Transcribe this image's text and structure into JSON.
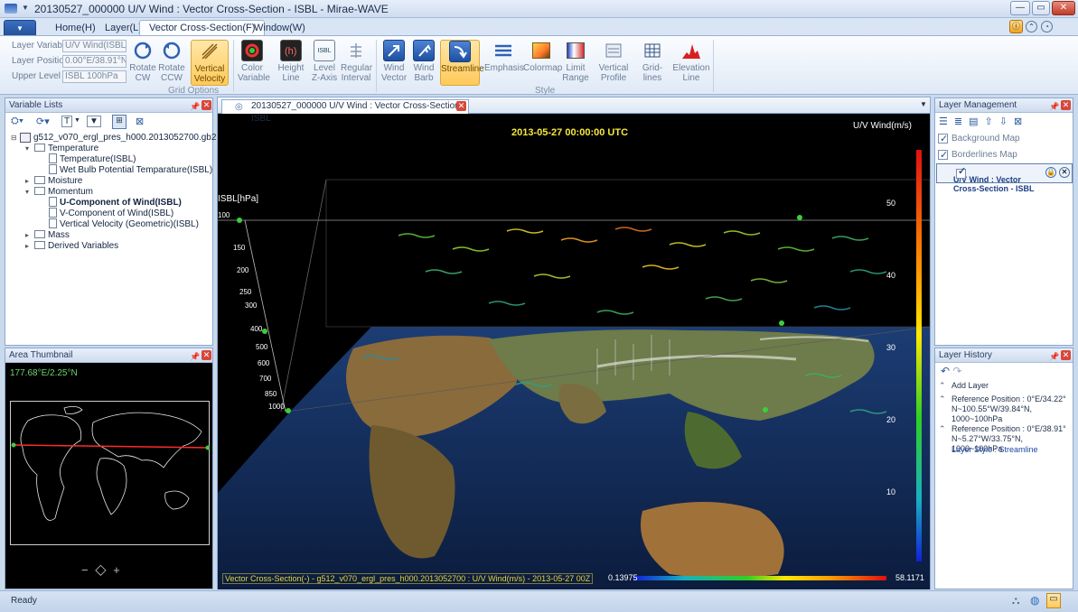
{
  "titlebar": {
    "title": "20130527_000000 U/V Wind : Vector Cross-Section - ISBL - Mirae-WAVE"
  },
  "tabs": [
    "Home(H)",
    "Layer(L)",
    "Vector Cross-Section(F)",
    "Window(W)"
  ],
  "ribbon": {
    "fields": [
      {
        "label": "Layer Variable",
        "value": "U/V Wind(ISBL)"
      },
      {
        "label": "Layer Position",
        "value": "0.00°E/38.91°N~"
      },
      {
        "label": "Upper Level",
        "value": "ISBL 100hPa"
      }
    ],
    "buttons": [
      {
        "label": "Rotate\nCW",
        "icon": "rotate-cw-icon"
      },
      {
        "label": "Rotate\nCCW",
        "icon": "rotate-ccw-icon"
      },
      {
        "label": "Vertical\nVelocity",
        "icon": "vertical-velocity-icon"
      },
      {
        "label": "Color\nVariable",
        "icon": "color-variable-icon"
      },
      {
        "label": "Height\nLine",
        "icon": "height-line-icon"
      },
      {
        "label": "Level\nZ-Axis",
        "icon": "level-zaxis-icon"
      },
      {
        "label": "Regular\nInterval",
        "icon": "regular-interval-icon"
      },
      {
        "label": "Wind\nVector",
        "icon": "wind-vector-icon"
      },
      {
        "label": "Wind\nBarb",
        "icon": "wind-barb-icon"
      },
      {
        "label": "Streamline",
        "icon": "streamline-icon"
      },
      {
        "label": "Emphasis",
        "icon": "emphasis-icon"
      },
      {
        "label": "Colormap",
        "icon": "colormap-icon"
      },
      {
        "label": "Limit\nRange",
        "icon": "limit-range-icon"
      },
      {
        "label": "Vertical\nProfile",
        "icon": "vertical-profile-icon"
      },
      {
        "label": "Grid-lines",
        "icon": "grid-lines-icon"
      },
      {
        "label": "Elevation\nLine",
        "icon": "elevation-line-icon"
      }
    ],
    "groups": {
      "grid_options": "Grid Options",
      "style": "Style"
    },
    "ribbon_icon_text": "ISBL"
  },
  "variables": {
    "title": "Variable Lists",
    "file": "g512_v070_ergl_pres_h000.2013052700.gb2",
    "tree": [
      {
        "label": "Temperature",
        "type": "folder",
        "depth": 1,
        "open": true
      },
      {
        "label": "Temperature(ISBL)",
        "type": "doc",
        "depth": 2
      },
      {
        "label": "Wet Bulb Potential Temparature(ISBL)",
        "type": "doc",
        "depth": 2
      },
      {
        "label": "Moisture",
        "type": "folder",
        "depth": 1,
        "open": false
      },
      {
        "label": "Momentum",
        "type": "folder",
        "depth": 1,
        "open": true
      },
      {
        "label": "U-Component of Wind(ISBL)",
        "type": "doc",
        "depth": 2,
        "bold": true
      },
      {
        "label": "V-Component of Wind(ISBL)",
        "type": "doc",
        "depth": 2
      },
      {
        "label": "Vertical Velocity (Geometric)(ISBL)",
        "type": "doc",
        "depth": 2
      },
      {
        "label": "Mass",
        "type": "folder",
        "depth": 1,
        "open": false
      },
      {
        "label": "Derived Variables",
        "type": "folder",
        "depth": 1,
        "open": false
      }
    ]
  },
  "thumbnail": {
    "title": "Area Thumbnail",
    "coords": "177.68°E/2.25°N"
  },
  "view": {
    "tab": "20130527_000000 U/V Wind : Vector Cross-Section - ISBL",
    "datetime": "2013-05-27 00:00:00 UTC",
    "colorbar_title": "U/V Wind(m/s)",
    "colorbar_ticks": [
      "50",
      "40",
      "30",
      "20",
      "10"
    ],
    "axis_title": "ISBL[hPa]",
    "levels": [
      "100",
      "150",
      "200",
      "250",
      "300",
      "400",
      "500",
      "600",
      "700",
      "850",
      "1000"
    ],
    "footer": "Vector Cross-Section(-) - g512_v070_ergl_pres_h000.2013052700 : U/V Wind(m/s) - 2013-05-27 00Z",
    "min": "0.13975",
    "max": "58.1171"
  },
  "layers": {
    "title": "Layer Management",
    "items": [
      {
        "label": "Background Map"
      },
      {
        "label": "Borderlines Map"
      },
      {
        "label": "U/V Wind : Vector Cross-Section - ISBL"
      }
    ]
  },
  "history": {
    "title": "Layer History",
    "items": [
      "Add Layer",
      "Reference Position : 0°E/34.22° N~100.55°W/39.84°N, 1000~100hPa",
      "Reference Position : 0°E/38.91° N~5.27°W/33.75°N, 1000~100hPa"
    ],
    "style": "Layer Style : Streamline"
  },
  "status": {
    "text": "Ready"
  }
}
